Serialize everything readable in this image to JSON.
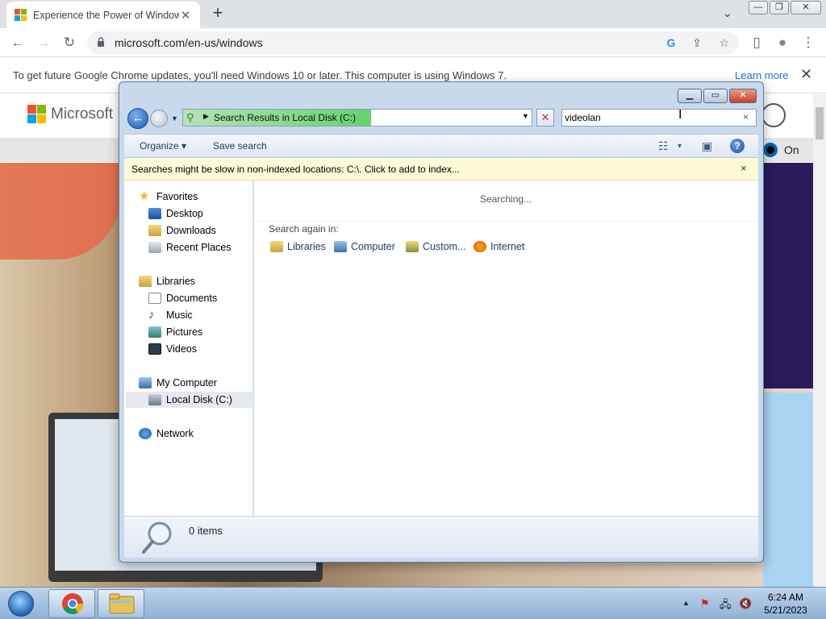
{
  "browser": {
    "tab_title": "Experience the Power of Window",
    "tab_close": "✕",
    "new_tab": "+",
    "tab_menu": "⌄",
    "window_controls": {
      "minimize": "—",
      "restore": "❐",
      "close": "✕"
    },
    "url": "microsoft.com/en-us/windows",
    "nav": {
      "back": "←",
      "forward": "→",
      "reload": "↻",
      "menu": "⋮"
    },
    "omnibox_icons": {
      "google": "G",
      "share": "⇪",
      "star": "☆",
      "sidepanel": "▯",
      "profile": "●"
    },
    "infobar": {
      "message": "To get future Google Chrome updates, you'll need Windows 10 or later. This computer is using Windows 7.",
      "link": "Learn more",
      "close": "✕"
    }
  },
  "page": {
    "brand": "Microsoft",
    "toggle_label": "On",
    "brand_colors": [
      "#f25022",
      "#7fba00",
      "#00a4ef",
      "#ffb900"
    ]
  },
  "explorer": {
    "controls": {
      "minimize": "▁",
      "maximize": "▭",
      "close": "✕"
    },
    "address": "Search Results in Local Disk (C:)",
    "address_progress": 0.54,
    "search_value": "videolan",
    "search_clear": "×",
    "stop": "✕",
    "commands": {
      "organize": "Organize ▾",
      "save_search": "Save search",
      "view": "☷",
      "view_dd": "▾",
      "preview": "▣",
      "help": "?"
    },
    "info_message": "Searches might be slow in non-indexed locations: C:\\. Click to add to index...",
    "info_close": "×",
    "nav": {
      "favorites": "Favorites",
      "desktop": "Desktop",
      "downloads": "Downloads",
      "recent": "Recent Places",
      "libraries": "Libraries",
      "documents": "Documents",
      "music": "Music",
      "pictures": "Pictures",
      "videos": "Videos",
      "computer": "My Computer",
      "localdisk": "Local Disk (C:)",
      "network": "Network"
    },
    "status": "Searching...",
    "search_again_label": "Search again in:",
    "search_again": [
      "Libraries",
      "Computer",
      "Custom...",
      "Internet"
    ],
    "items_count": "0 items"
  },
  "taskbar": {
    "time": "6:24 AM",
    "date": "5/21/2023",
    "tray": {
      "arrow": "▲",
      "flag": "⚑",
      "network": "🖧",
      "volume": "🔇"
    }
  }
}
